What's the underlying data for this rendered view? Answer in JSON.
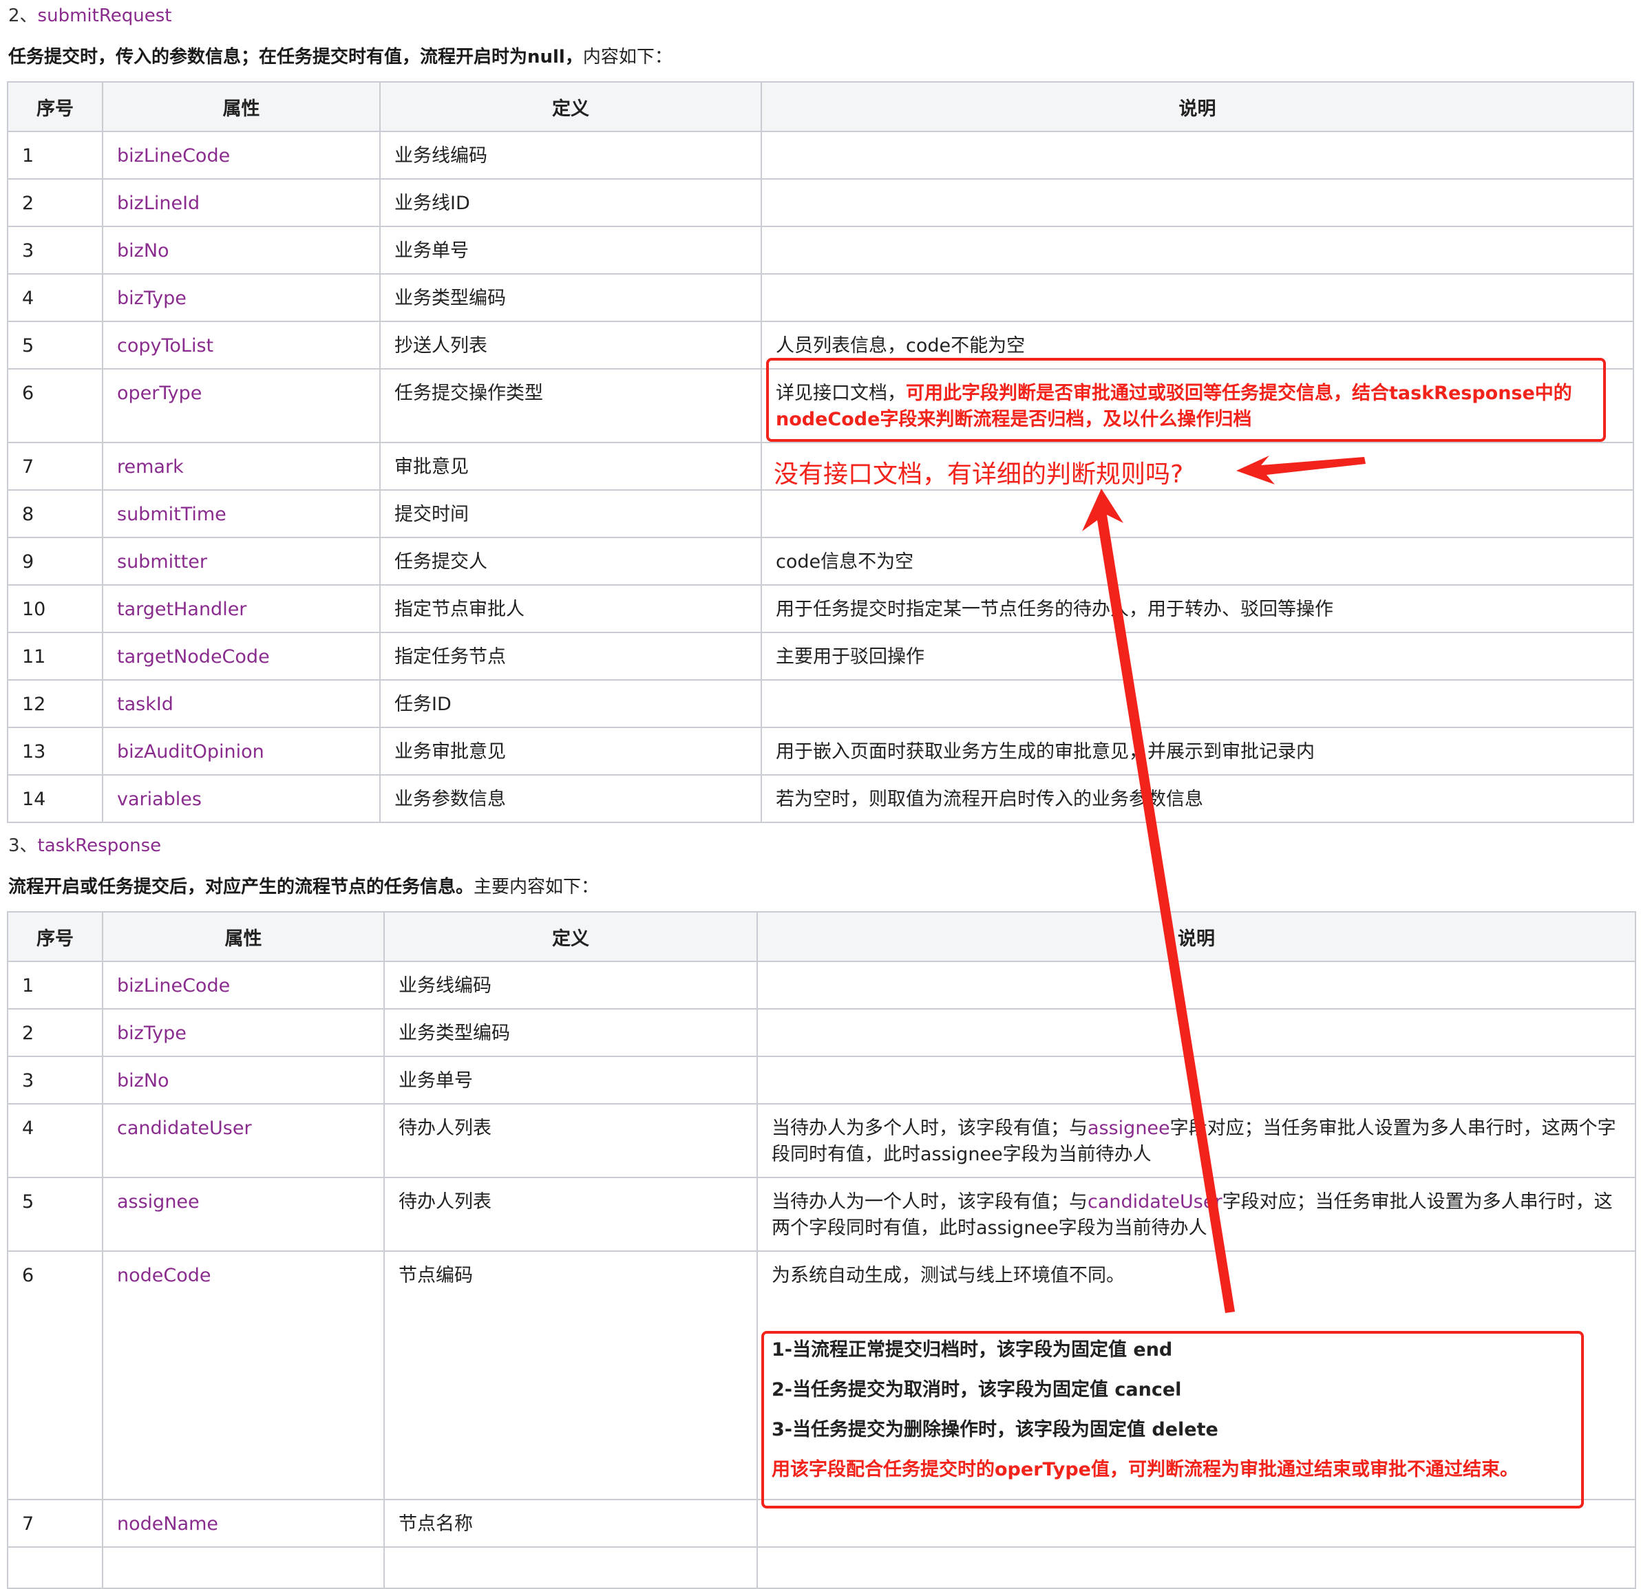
{
  "section2": {
    "num": "2、",
    "name": "submitRequest",
    "intro_bold": "任务提交时，传入的参数信息；在任务提交时有值，流程开启时为null，",
    "intro_rest": "内容如下："
  },
  "table1": {
    "headers": [
      "序号",
      "属性",
      "定义",
      "说明"
    ],
    "rows": [
      {
        "no": "1",
        "prop": "bizLineCode",
        "def": "业务线编码",
        "desc": ""
      },
      {
        "no": "2",
        "prop": "bizLineId",
        "def": "业务线ID",
        "desc": ""
      },
      {
        "no": "3",
        "prop": "bizNo",
        "def": "业务单号",
        "desc": ""
      },
      {
        "no": "4",
        "prop": "bizType",
        "def": "业务类型编码",
        "desc": ""
      },
      {
        "no": "5",
        "prop": "copyToList",
        "def": "抄送人列表",
        "desc": "人员列表信息，code不能为空"
      },
      {
        "no": "6",
        "prop": "operType",
        "def": "任务提交操作类型",
        "desc_plain": "详见接口文档，",
        "desc_red": "可用此字段判断是否审批通过或驳回等任务提交信息，结合taskResponse中的nodeCode字段来判断流程是否归档，及以什么操作归档"
      },
      {
        "no": "7",
        "prop": "remark",
        "def": "审批意见",
        "desc": ""
      },
      {
        "no": "8",
        "prop": "submitTime",
        "def": "提交时间",
        "desc": ""
      },
      {
        "no": "9",
        "prop": "submitter",
        "def": "任务提交人",
        "desc": "code信息不为空"
      },
      {
        "no": "10",
        "prop": "targetHandler",
        "def": "指定节点审批人",
        "desc": "用于任务提交时指定某一节点任务的待办人，用于转办、驳回等操作"
      },
      {
        "no": "11",
        "prop": "targetNodeCode",
        "def": "指定任务节点",
        "desc": "主要用于驳回操作"
      },
      {
        "no": "12",
        "prop": "taskId",
        "def": "任务ID",
        "desc": ""
      },
      {
        "no": "13",
        "prop": "bizAuditOpinion",
        "def": "业务审批意见",
        "desc": "用于嵌入页面时获取业务方生成的审批意见，并展示到审批记录内"
      },
      {
        "no": "14",
        "prop": "variables",
        "def": "业务参数信息",
        "desc": "若为空时，则取值为流程开启时传入的业务参数信息"
      }
    ]
  },
  "section3": {
    "num": "3、",
    "name": "taskResponse",
    "intro_bold": "流程开启或任务提交后，对应产生的流程节点的任务信息。",
    "intro_rest": "主要内容如下："
  },
  "table2": {
    "headers": [
      "序号",
      "属性",
      "定义",
      "说明"
    ],
    "rows": [
      {
        "no": "1",
        "prop": "bizLineCode",
        "def": "业务线编码",
        "desc": ""
      },
      {
        "no": "2",
        "prop": "bizType",
        "def": "业务类型编码",
        "desc": ""
      },
      {
        "no": "3",
        "prop": "bizNo",
        "def": "业务单号",
        "desc": ""
      },
      {
        "no": "4",
        "prop": "candidateUser",
        "def": "待办人列表",
        "desc_a": "当待办人为多个人时，该字段有值；与",
        "desc_link": "assignee",
        "desc_b": "字段对应；当任务审批人设置为多人串行时，这两个字段同时有值，此时assignee字段为当前待办人"
      },
      {
        "no": "5",
        "prop": "assignee",
        "def": "待办人列表",
        "desc_a": "当待办人为一个人时，该字段有值；与",
        "desc_link": "candidateUser",
        "desc_b": "字段对应；当任务审批人设置为多人串行时，这两个字段同时有值，此时assignee字段为当前待办人"
      },
      {
        "no": "6",
        "prop": "nodeCode",
        "def": "节点编码",
        "desc": "为系统自动生成，测试与线上环境值不同。",
        "rules": [
          "1-当流程正常提交归档时，该字段为固定值 end",
          "2-当任务提交为取消时，该字段为固定值  cancel",
          "3-当任务提交为删除操作时，该字段为固定值  delete"
        ],
        "rule_red": "用该字段配合任务提交时的operType值，可判断流程为审批通过结束或审批不通过结束。"
      },
      {
        "no": "7",
        "prop": "nodeName",
        "def": "节点名称",
        "desc": ""
      }
    ]
  },
  "annotation": {
    "comment": "没有接口文档，有详细的判断规则吗?",
    "color": "#f2231b"
  }
}
